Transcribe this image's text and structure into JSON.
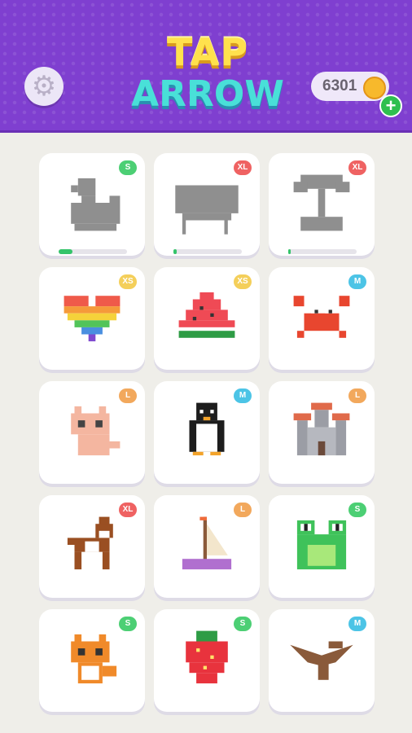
{
  "header": {
    "logo_line1": "TAP",
    "logo_line2": "ARROW",
    "coins": "6301",
    "settings_icon": "gear-icon",
    "add_icon": "plus-icon"
  },
  "levels": [
    {
      "name": "duck",
      "size": "S",
      "count": "",
      "progress": 0.2,
      "state": "locked"
    },
    {
      "name": "piano",
      "size": "XL",
      "count": "",
      "progress": 0.05,
      "state": "locked"
    },
    {
      "name": "palm-island",
      "size": "XL",
      "count": "",
      "progress": 0.03,
      "state": "locked"
    },
    {
      "name": "rainbow-heart",
      "size": "XS",
      "count": "",
      "state": "done"
    },
    {
      "name": "watermelon",
      "size": "XS",
      "count": "",
      "state": "done"
    },
    {
      "name": "crab",
      "size": "M",
      "count": "",
      "state": "done"
    },
    {
      "name": "cat",
      "size": "L",
      "count": "",
      "state": "done"
    },
    {
      "name": "penguin",
      "size": "M",
      "count": "",
      "state": "done"
    },
    {
      "name": "castle",
      "size": "L",
      "count": "",
      "state": "done"
    },
    {
      "name": "dog",
      "size": "XL",
      "count": "",
      "state": "done"
    },
    {
      "name": "sailboat",
      "size": "L",
      "count": "",
      "state": "done"
    },
    {
      "name": "frog",
      "size": "S",
      "count": "",
      "state": "done"
    },
    {
      "name": "fox",
      "size": "S",
      "count": "",
      "state": "done"
    },
    {
      "name": "strawberry",
      "size": "S",
      "count": "",
      "state": "done"
    },
    {
      "name": "pterodactyl",
      "size": "M",
      "count": "",
      "state": "done"
    }
  ]
}
